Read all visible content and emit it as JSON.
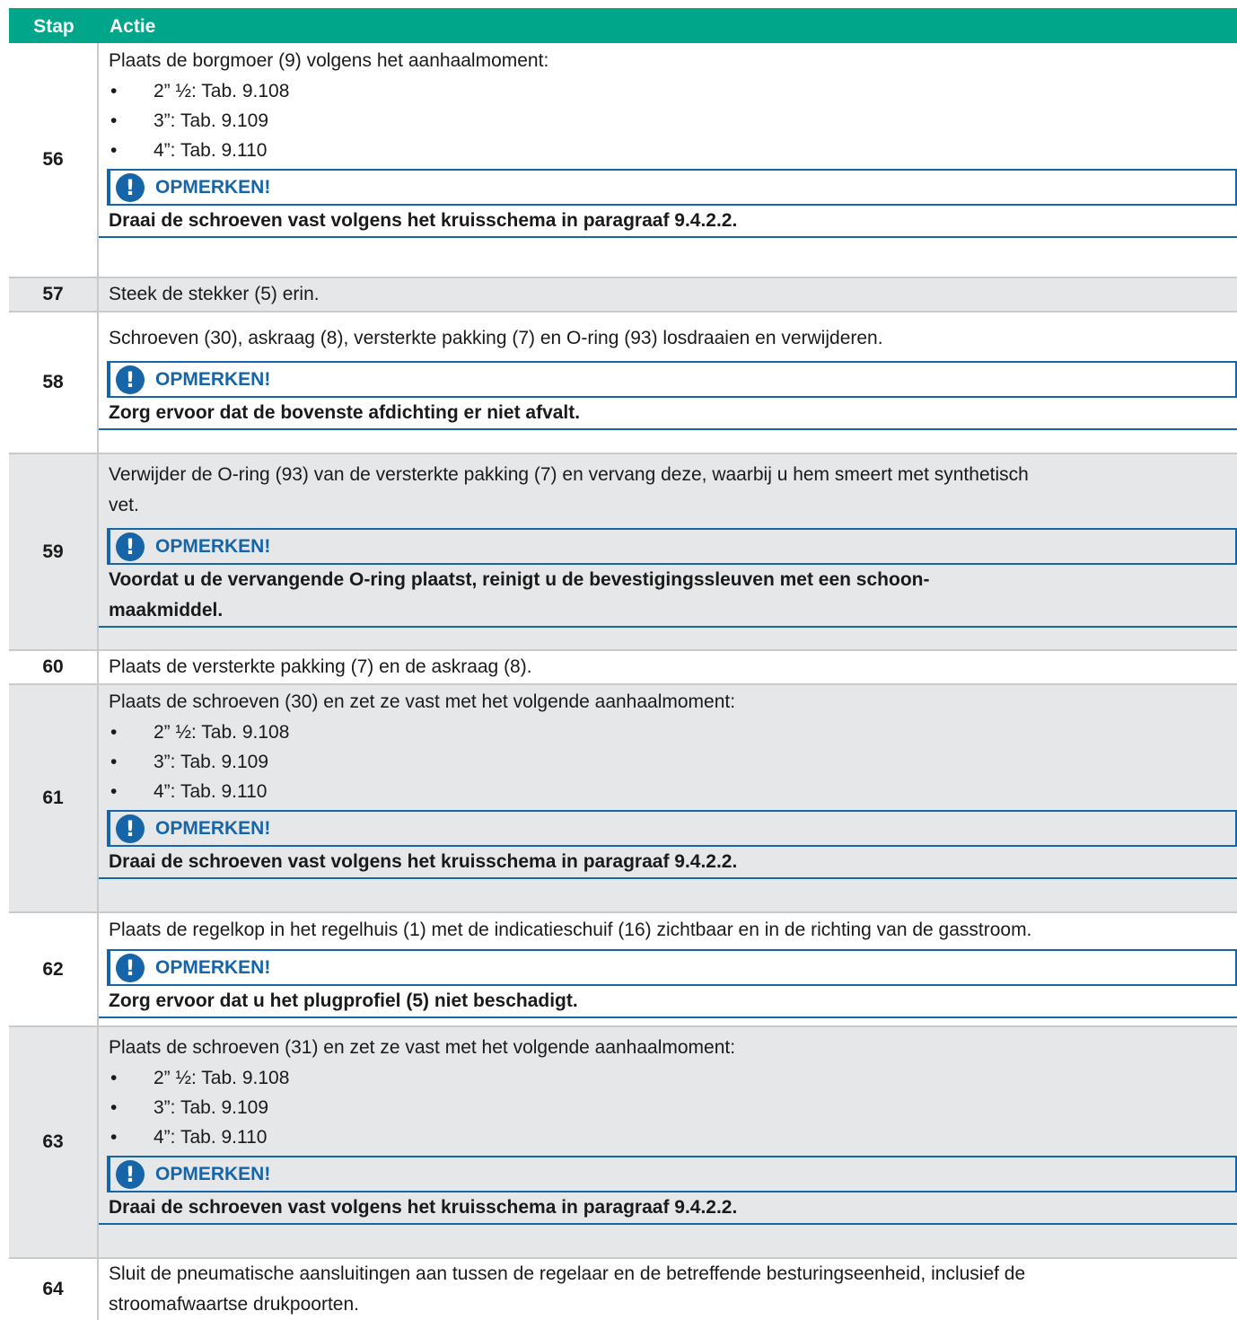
{
  "header": {
    "col_step": "Stap",
    "col_action": "Actie"
  },
  "note_title": "OPMERKEN!",
  "rows": [
    {
      "step": "56",
      "intro": "Plaats de borgmoer (9) volgens het aanhaalmoment:",
      "bullets": [
        "2” ½: Tab. 9.108",
        "3”: Tab. 9.109",
        "4”: Tab. 9.110"
      ],
      "note": "Draai de schroeven vast volgens het kruisschema in paragraaf 9.4.2.2."
    },
    {
      "step": "57",
      "intro": "Steek de stekker (5) erin."
    },
    {
      "step": "58",
      "intro": "Schroeven (30), askraag (8), versterkte pakking (7) en O-ring (93) losdraaien en verwijderen.",
      "note": "Zorg ervoor dat de bovenste afdichting er niet afvalt."
    },
    {
      "step": "59",
      "intro": "Verwijder de O-ring (93) van de versterkte pakking (7) en vervang deze, waarbij u hem smeert met synthetisch",
      "intro2": "vet.",
      "note": "Voordat u de vervangende O-ring plaatst, reinigt u de bevestigingssleuven met een schoon-",
      "note2": "maakmiddel."
    },
    {
      "step": "60",
      "intro": "Plaats de versterkte pakking (7) en de askraag (8)."
    },
    {
      "step": "61",
      "intro": "Plaats de schroeven (30) en zet ze vast met het volgende aanhaalmoment:",
      "bullets": [
        "2” ½: Tab. 9.108",
        "3”: Tab. 9.109",
        "4”: Tab. 9.110"
      ],
      "note": "Draai de schroeven vast volgens het kruisschema in paragraaf 9.4.2.2."
    },
    {
      "step": "62",
      "intro": "Plaats de regelkop in het regelhuis (1) met de indicatieschuif (16) zichtbaar en in de richting van de gasstroom.",
      "note": "Zorg ervoor dat u het plugprofiel (5) niet beschadigt."
    },
    {
      "step": "63",
      "intro": "Plaats de schroeven (31) en zet ze vast met het volgende aanhaalmoment:",
      "bullets": [
        "2” ½: Tab. 9.108",
        "3”: Tab. 9.109",
        "4”: Tab. 9.110"
      ],
      "note": "Draai de schroeven vast volgens het kruisschema in paragraaf 9.4.2.2."
    },
    {
      "step": "64",
      "intro": "Sluit de pneumatische aansluitingen aan tussen de regelaar en de betreffende besturingseenheid, inclusief de",
      "intro2": "stroomafwaartse drukpoorten."
    }
  ]
}
